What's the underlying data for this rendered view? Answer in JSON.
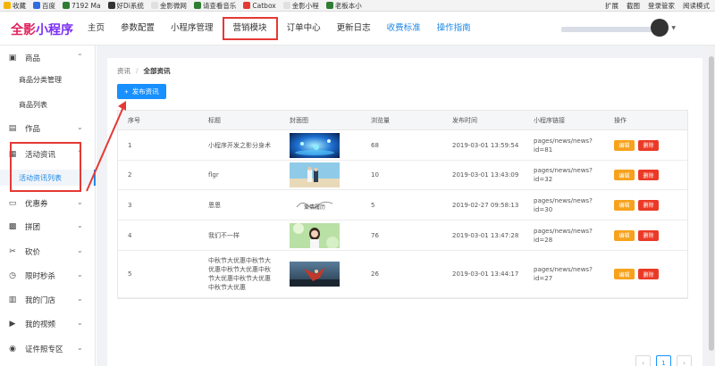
{
  "browser": {
    "bookmarks": [
      {
        "label": "收藏",
        "color": "#f5b400"
      },
      {
        "label": "百度",
        "color": "#2f6de1"
      },
      {
        "label": "7192 Ma",
        "color": "#2e7d32"
      },
      {
        "label": "好Di系统",
        "color": "#333333"
      },
      {
        "label": "金影微网",
        "color": "#e0e0e0"
      },
      {
        "label": "请查看音乐",
        "color": "#2e7d32"
      },
      {
        "label": "Catbox",
        "color": "#e53935"
      },
      {
        "label": "金影小程",
        "color": "#e0e0e0"
      },
      {
        "label": "老板本小",
        "color": "#2e7d32"
      }
    ],
    "right_tools": [
      "扩展",
      "截图",
      "登录管家",
      "阅读模式"
    ]
  },
  "header": {
    "logo_part1": "全影",
    "logo_part2": "小程序",
    "nav": [
      {
        "label": "主页",
        "style": "normal"
      },
      {
        "label": "参数配置",
        "style": "normal"
      },
      {
        "label": "小程序管理",
        "style": "normal"
      },
      {
        "label": "营销模块",
        "style": "boxed"
      },
      {
        "label": "订单中心",
        "style": "normal"
      },
      {
        "label": "更新日志",
        "style": "normal"
      },
      {
        "label": "收费标准",
        "style": "blue"
      },
      {
        "label": "操作指南",
        "style": "blue"
      }
    ]
  },
  "sidebar": {
    "items": [
      {
        "label": "商品",
        "icon": "bag-icon",
        "chevron": "up"
      },
      {
        "sub": "商品分类管理"
      },
      {
        "sub": "商品列表"
      },
      {
        "label": "作品",
        "icon": "briefcase-icon",
        "chevron": "down"
      },
      {
        "label": "活动资讯",
        "icon": "newspaper-icon",
        "chevron": "up"
      },
      {
        "sub": "活动资讯列表",
        "active": true
      },
      {
        "label": "优惠券",
        "icon": "ticket-icon",
        "chevron": "down"
      },
      {
        "label": "拼团",
        "icon": "gift-icon",
        "chevron": "down"
      },
      {
        "label": "砍价",
        "icon": "scissors-icon",
        "chevron": "down"
      },
      {
        "label": "限时秒杀",
        "icon": "clock-icon",
        "chevron": "down"
      },
      {
        "label": "我的门店",
        "icon": "store-icon",
        "chevron": "down"
      },
      {
        "label": "我的视频",
        "icon": "video-icon",
        "chevron": "down"
      },
      {
        "label": "证件照专区",
        "icon": "camera-icon",
        "chevron": "down"
      }
    ]
  },
  "breadcrumb": {
    "root": "资讯",
    "current": "全部资讯"
  },
  "publish_button": "发布资讯",
  "table": {
    "headers": [
      "序号",
      "标题",
      "封面图",
      "浏览量",
      "发布时间",
      "小程序链接",
      "操作"
    ],
    "rows": [
      {
        "no": "1",
        "title": "小程序开发之影分身术",
        "cover": "cover-blue-lights",
        "views": "68",
        "time": "2019-03-01 13:59:54",
        "link": "pages/news/news?id=81"
      },
      {
        "no": "2",
        "title": "flgr",
        "cover": "cover-couple-beach",
        "views": "10",
        "time": "2019-03-01 13:43:09",
        "link": "pages/news/news?id=32"
      },
      {
        "no": "3",
        "title": "恩恩",
        "cover": "cover-text-logo",
        "views": "5",
        "time": "2019-02-27 09:58:13",
        "link": "pages/news/news?id=30"
      },
      {
        "no": "4",
        "title": "我们不一样",
        "cover": "cover-girl-portrait",
        "views": "76",
        "time": "2019-03-01 13:47:28",
        "link": "pages/news/news?id=28"
      },
      {
        "no": "5",
        "title": "中秋节大优惠中秋节大优惠中秋节大优惠中秋节大优惠中秋节大优惠中秋节大优惠",
        "cover": "cover-dancer",
        "views": "26",
        "time": "2019-03-01 13:44:17",
        "link": "pages/news/news?id=27"
      }
    ],
    "edit_label": "编辑",
    "delete_label": "删除",
    "cover_text": "爱情履历"
  },
  "pagination": {
    "prev": "‹",
    "current": "1",
    "next": "›"
  },
  "colors": {
    "primary": "#1890ff",
    "edit": "#f7a21d",
    "delete": "#ea3a26",
    "annotation": "#e53935"
  }
}
